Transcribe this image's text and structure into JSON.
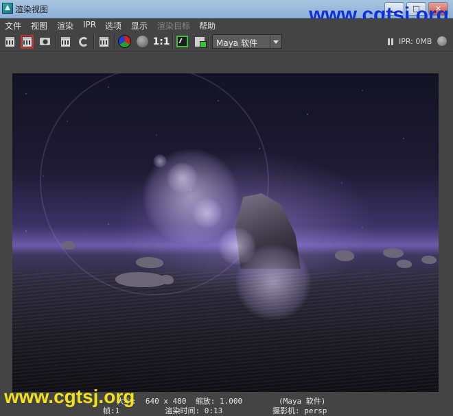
{
  "window": {
    "title": "渲染视图",
    "minimize_label": "▁",
    "maximize_label": "□",
    "close_label": "✕"
  },
  "watermark": {
    "top": "www.cgtsj.org",
    "bottom": "www.cgtsj.org",
    "top_color": "#1030d8",
    "bottom_color": "#f2e01a"
  },
  "menu": {
    "items": [
      {
        "label": "文件",
        "enabled": true
      },
      {
        "label": "视图",
        "enabled": true
      },
      {
        "label": "渲染",
        "enabled": true
      },
      {
        "label": "IPR",
        "enabled": true
      },
      {
        "label": "选项",
        "enabled": true
      },
      {
        "label": "显示",
        "enabled": true
      },
      {
        "label": "渲染目标",
        "enabled": false
      },
      {
        "label": "帮助",
        "enabled": true
      }
    ]
  },
  "toolbar": {
    "icons": [
      "render-clapper-icon",
      "ipr-render-clapper-icon",
      "snapshot-camera-icon",
      "render-region-clapper-icon",
      "refresh-ipr-icon",
      "render-settings-icon",
      "rgb-channels-icon",
      "alpha-channel-icon",
      "real-size-icon",
      "keep-image-icon",
      "remove-image-icon"
    ],
    "ratio_label": "1:1",
    "renderer": "Maya 软件",
    "ipr_memory": "IPR: 0MB"
  },
  "render_info": {
    "line1": "大小:  640 x 480  缩放: 1.000        (Maya 软件)",
    "line2": "帧:1          渲染时间: 0:13           摄影机: persp"
  }
}
